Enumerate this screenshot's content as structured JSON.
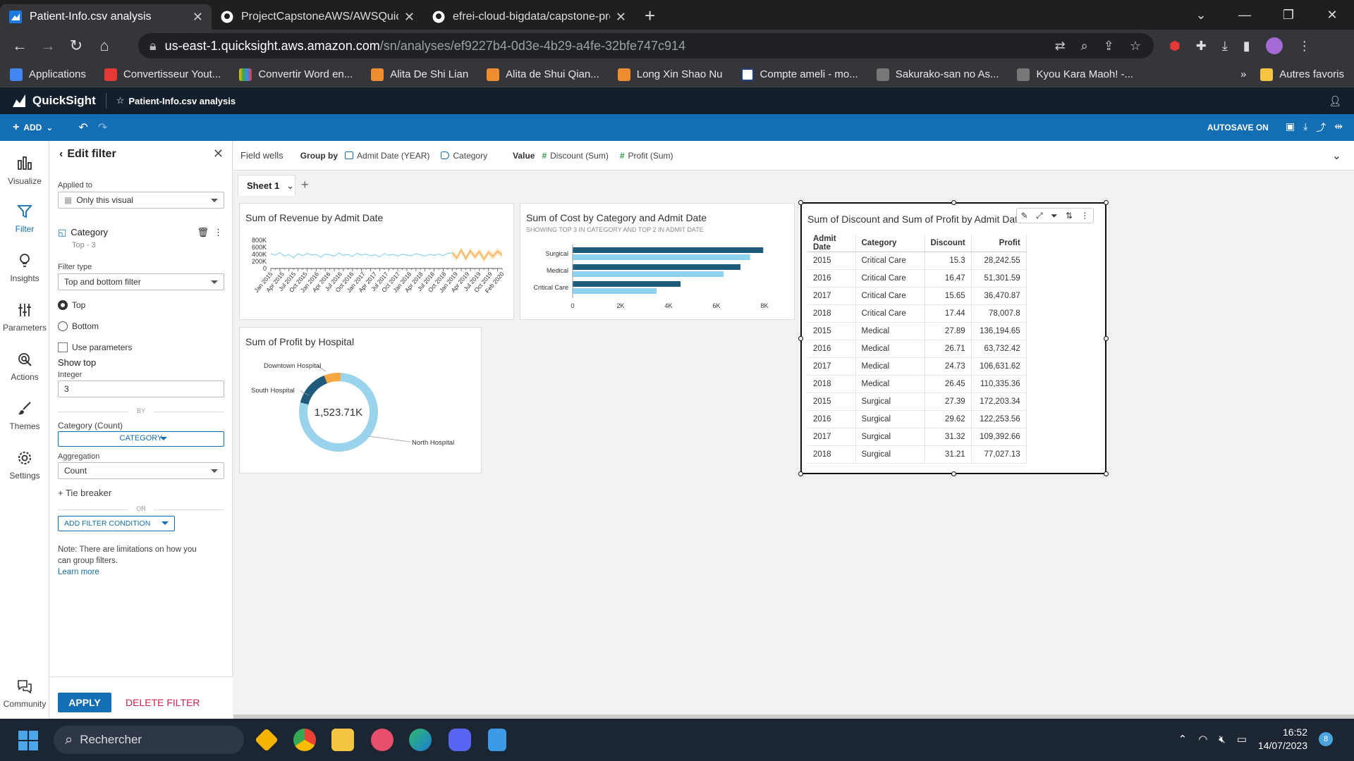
{
  "browser": {
    "tabs": [
      {
        "title": "Patient-Info.csv analysis",
        "active": true
      },
      {
        "title": "ProjectCapstoneAWS/AWSQuickS",
        "active": false
      },
      {
        "title": "efrei-cloud-bigdata/capstone-pro",
        "active": false
      }
    ],
    "url_host": "us-east-1.quicksight.aws.amazon.com",
    "url_path": "/sn/analyses/ef9227b4-0d3e-4b29-a4fe-32bfe747c914",
    "bookmarks": [
      {
        "label": "Applications",
        "color": "#4285f4"
      },
      {
        "label": "Convertisseur Yout...",
        "color": "#e53935"
      },
      {
        "label": "Convertir Word en...",
        "color": "#fbbc04"
      },
      {
        "label": "Alita De Shi Lian",
        "color": "#f08c30"
      },
      {
        "label": "Alita de Shui Qian...",
        "color": "#f08c30"
      },
      {
        "label": "Long Xin Shao Nu",
        "color": "#f08c30"
      },
      {
        "label": "Compte ameli - mo...",
        "color": "#1d3e8f"
      },
      {
        "label": "Sakurako-san no As...",
        "color": "#888888"
      },
      {
        "label": "Kyou Kara Maoh! -...",
        "color": "#888888"
      }
    ],
    "bookmarks_more": "»",
    "other_bookmarks": "Autres favoris"
  },
  "quicksight": {
    "brand": "QuickSight",
    "analysis_title": "Patient-Info.csv analysis",
    "add_label": "ADD",
    "autosave_label": "AUTOSAVE ON"
  },
  "leftnav": [
    {
      "label": "Visualize"
    },
    {
      "label": "Filter"
    },
    {
      "label": "Insights"
    },
    {
      "label": "Parameters"
    },
    {
      "label": "Actions"
    },
    {
      "label": "Themes"
    },
    {
      "label": "Settings"
    },
    {
      "label": "Community"
    }
  ],
  "filter_panel": {
    "header": "Edit filter",
    "applied_to_label": "Applied to",
    "applied_to_value": "Only this visual",
    "field_name": "Category",
    "field_sub": "Top - 3",
    "filter_type_label": "Filter type",
    "filter_type_value": "Top and bottom filter",
    "radio_top": "Top",
    "radio_bottom": "Bottom",
    "use_params": "Use parameters",
    "show_top": "Show top",
    "integer_label": "Integer",
    "integer_value": "3",
    "by_label": "BY",
    "by_field_label": "Category (Count)",
    "by_field_value": "CATEGORY",
    "aggregation_label": "Aggregation",
    "aggregation_value": "Count",
    "tie_breaker": "Tie breaker",
    "or_label": "OR",
    "add_condition": "ADD FILTER CONDITION",
    "note": "Note: There are limitations on how you can group filters.",
    "learn_more": "Learn more",
    "apply": "APPLY",
    "delete": "DELETE FILTER"
  },
  "field_wells": {
    "label": "Field wells",
    "group_by": "Group by",
    "group_items": [
      "Admit Date (YEAR)",
      "Category"
    ],
    "value_label": "Value",
    "value_items": [
      "Discount (Sum)",
      "Profit (Sum)"
    ]
  },
  "sheet": {
    "tab": "Sheet 1"
  },
  "visuals": {
    "revenue_title": "Sum of Revenue by Admit Date",
    "cost_title": "Sum of Cost by Category and Admit Date",
    "cost_sub": "SHOWING TOP 3 IN CATEGORY AND TOP 2 IN ADMIT DATE",
    "profit_title": "Sum of Profit by Hospital",
    "table_title": "Sum of Discount and Sum of Profit by Admit Date and Category"
  },
  "chart_data": [
    {
      "type": "line",
      "title": "Sum of Revenue by Admit Date",
      "y_ticks": [
        "800K",
        "600K",
        "400K",
        "200K",
        "0"
      ],
      "ylim": [
        0,
        800000
      ],
      "x_ticks": [
        "Jan 2015",
        "Apr 2015",
        "Jul 2015",
        "Oct 2015",
        "Jan 2016",
        "Apr 2016",
        "Jul 2016",
        "Oct 2016",
        "Jan 2017",
        "Apr 2017",
        "Jul 2017",
        "Oct 2017",
        "Jan 2018",
        "Apr 2018",
        "Jul 2018",
        "Oct 2018",
        "Jan 2019",
        "Apr 2019",
        "Jul 2019",
        "Oct 2019",
        "Feb 2020"
      ],
      "values": [
        420000,
        380000,
        450000,
        350000,
        400000,
        300000,
        420000,
        360000,
        430000,
        380000,
        400000,
        320000,
        410000,
        390000,
        350000,
        440000,
        370000,
        400000,
        340000,
        430000,
        380000,
        410000,
        360000,
        390000,
        330000,
        420000,
        370000,
        400000,
        350000,
        410000,
        380000,
        360000,
        420000,
        390000,
        350000,
        400000,
        370000,
        410000,
        360000,
        430000,
        440000,
        300000,
        520000,
        280000,
        500000,
        330000,
        480000,
        260000,
        460000,
        340000,
        490000,
        380000
      ],
      "forecast_start_index": 40
    },
    {
      "type": "bar",
      "title": "Sum of Cost by Category and Admit Date",
      "categories": [
        "Surgical",
        "Medical",
        "Critical Care"
      ],
      "series": [
        {
          "values": [
            7950,
            7000,
            4500
          ],
          "color": "#1e5a7a"
        },
        {
          "values": [
            7400,
            6300,
            3500
          ],
          "color": "#8ed3ee"
        }
      ],
      "x_ticks": [
        "0",
        "2K",
        "4K",
        "6K",
        "8K"
      ],
      "xlim": [
        0,
        8000
      ]
    },
    {
      "type": "pie",
      "title": "Sum of Profit by Hospital",
      "center_label": "1,523.71K",
      "slices": [
        {
          "label": "North Hospital",
          "share": 0.78,
          "color": "#99d3ec"
        },
        {
          "label": "South Hospital",
          "share": 0.15,
          "color": "#1e5a7a"
        },
        {
          "label": "Downtown Hospital",
          "share": 0.07,
          "color": "#f5a742"
        }
      ]
    },
    {
      "type": "table",
      "title": "Sum of Discount and Sum of Profit by Admit Date and Category",
      "columns": [
        "Admit Date",
        "Category",
        "Discount",
        "Profit"
      ],
      "rows": [
        [
          "2015",
          "Critical Care",
          "15.3",
          "28,242.55"
        ],
        [
          "2016",
          "Critical Care",
          "16.47",
          "51,301.59"
        ],
        [
          "2017",
          "Critical Care",
          "15.65",
          "36,470.87"
        ],
        [
          "2018",
          "Critical Care",
          "17.44",
          "78,007.8"
        ],
        [
          "2015",
          "Medical",
          "27.89",
          "136,194.65"
        ],
        [
          "2016",
          "Medical",
          "26.71",
          "63,732.42"
        ],
        [
          "2017",
          "Medical",
          "24.73",
          "106,631.62"
        ],
        [
          "2018",
          "Medical",
          "26.45",
          "110,335.36"
        ],
        [
          "2015",
          "Surgical",
          "27.39",
          "172,203.34"
        ],
        [
          "2016",
          "Surgical",
          "29.62",
          "122,253.56"
        ],
        [
          "2017",
          "Surgical",
          "31.32",
          "109,392.66"
        ],
        [
          "2018",
          "Surgical",
          "31.21",
          "77,027.13"
        ]
      ]
    }
  ],
  "taskbar": {
    "search": "Rechercher",
    "time": "16:52",
    "date": "14/07/2023",
    "notifications": "8"
  }
}
